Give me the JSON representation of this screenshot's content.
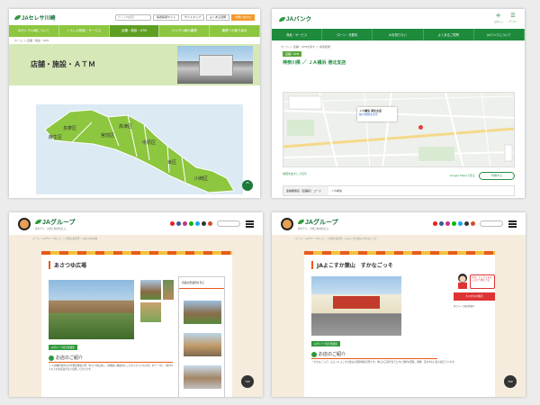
{
  "panel1": {
    "logo": "JAセレサ川崎",
    "search_placeholder": "サイト内検索",
    "header_buttons": [
      "採用情報サイト",
      "サイトマップ",
      "よくある質問"
    ],
    "header_button_orange": "お問い合わせ",
    "nav": [
      "JAセレサ川崎について",
      "くらしの相談・サービス",
      "店舗・施設・ATM",
      "セレサ川崎の農業",
      "農業への取り組み"
    ],
    "breadcrumb": "ホーム ＞ 店舗・施設・ATM",
    "hero_title": "店舗・施設・ＡＴＭ",
    "districts": [
      "多摩区",
      "麻生区",
      "高津区",
      "宮前区",
      "中原区",
      "幸区",
      "川崎区"
    ],
    "up_button": "^",
    "colors": {
      "nav": "#8dc63f",
      "hero": "#d6e8b7",
      "map_land": "#8dc63f",
      "sea": "#dbeaf3"
    }
  },
  "panel2": {
    "logo": "JAバンク",
    "top_icons": [
      "ログイン",
      "メニュー"
    ],
    "nav": [
      "商品・サービス",
      "ローン・手数料",
      "JAを知りたい",
      "よくあるご質問",
      "JAバンクについて"
    ],
    "breadcrumb": "ホーム ＞ 店舗・ATMを探す ＞ 検索結果",
    "badge": "店舗・ATM",
    "title": "神奈川県 ／ ＪＡ横浜 港北支店",
    "map_popup_title": "ＪＡ横浜 港北支店",
    "map_popup_text": "拡大地図を表示",
    "map_footer_link": "地図を拡大して表示",
    "google_maps_link": "Google Mapsで見る",
    "print_button": "印刷する",
    "table_header": "金融機関名（店舗名）コード",
    "table_value": "ＪＡ横浜"
  },
  "panel3": {
    "logo": "JAグループ",
    "tagline": "食を守り、大地と地域を結ぶ。",
    "breadcrumb": "ホーム ＞ JAグループのこと ＞ 全国の直売所 ＞ あさつゆ広場",
    "title": "あさつゆ広場",
    "green_tag": "JAグループ直売所検索",
    "section_title": "お店のご紹介",
    "desc": "Ｊ Ａ前橋市管内の大型農産物直売所「あさつゆ広場」。「前橋産に徹底的にこだわったいいものを」をテーマに、約150人以上の生産者が日々出荷しております。",
    "sidebar_title": "店舗の農業所を見る",
    "top_button": "TOP"
  },
  "panel4": {
    "logo": "JAグループ",
    "tagline": "食を守り、大地と地域を結ぶ。",
    "breadcrumb": "ホーム ＞ JAグループのこと ＞ 全国の直売所 ＞ JAよこすか葉山 すかなごっそ",
    "title": "JAよこすか葉山　すかなごっそ",
    "green_tag": "JAグループ直売所検索",
    "section_title": "お店のご紹介",
    "desc": "「すかなごっそ」とは、JA よこすか葉山の農産物直売所です。地元の三浦半島でとれた新鮮な野菜、果物、花を中心に取り揃えています。",
    "bubble_text": "今日、どこから来ましたか？教えてね",
    "red_button": "ちゃがわの販売",
    "side_link": "JAグループ直売所紹介",
    "top_button": "TOP"
  }
}
